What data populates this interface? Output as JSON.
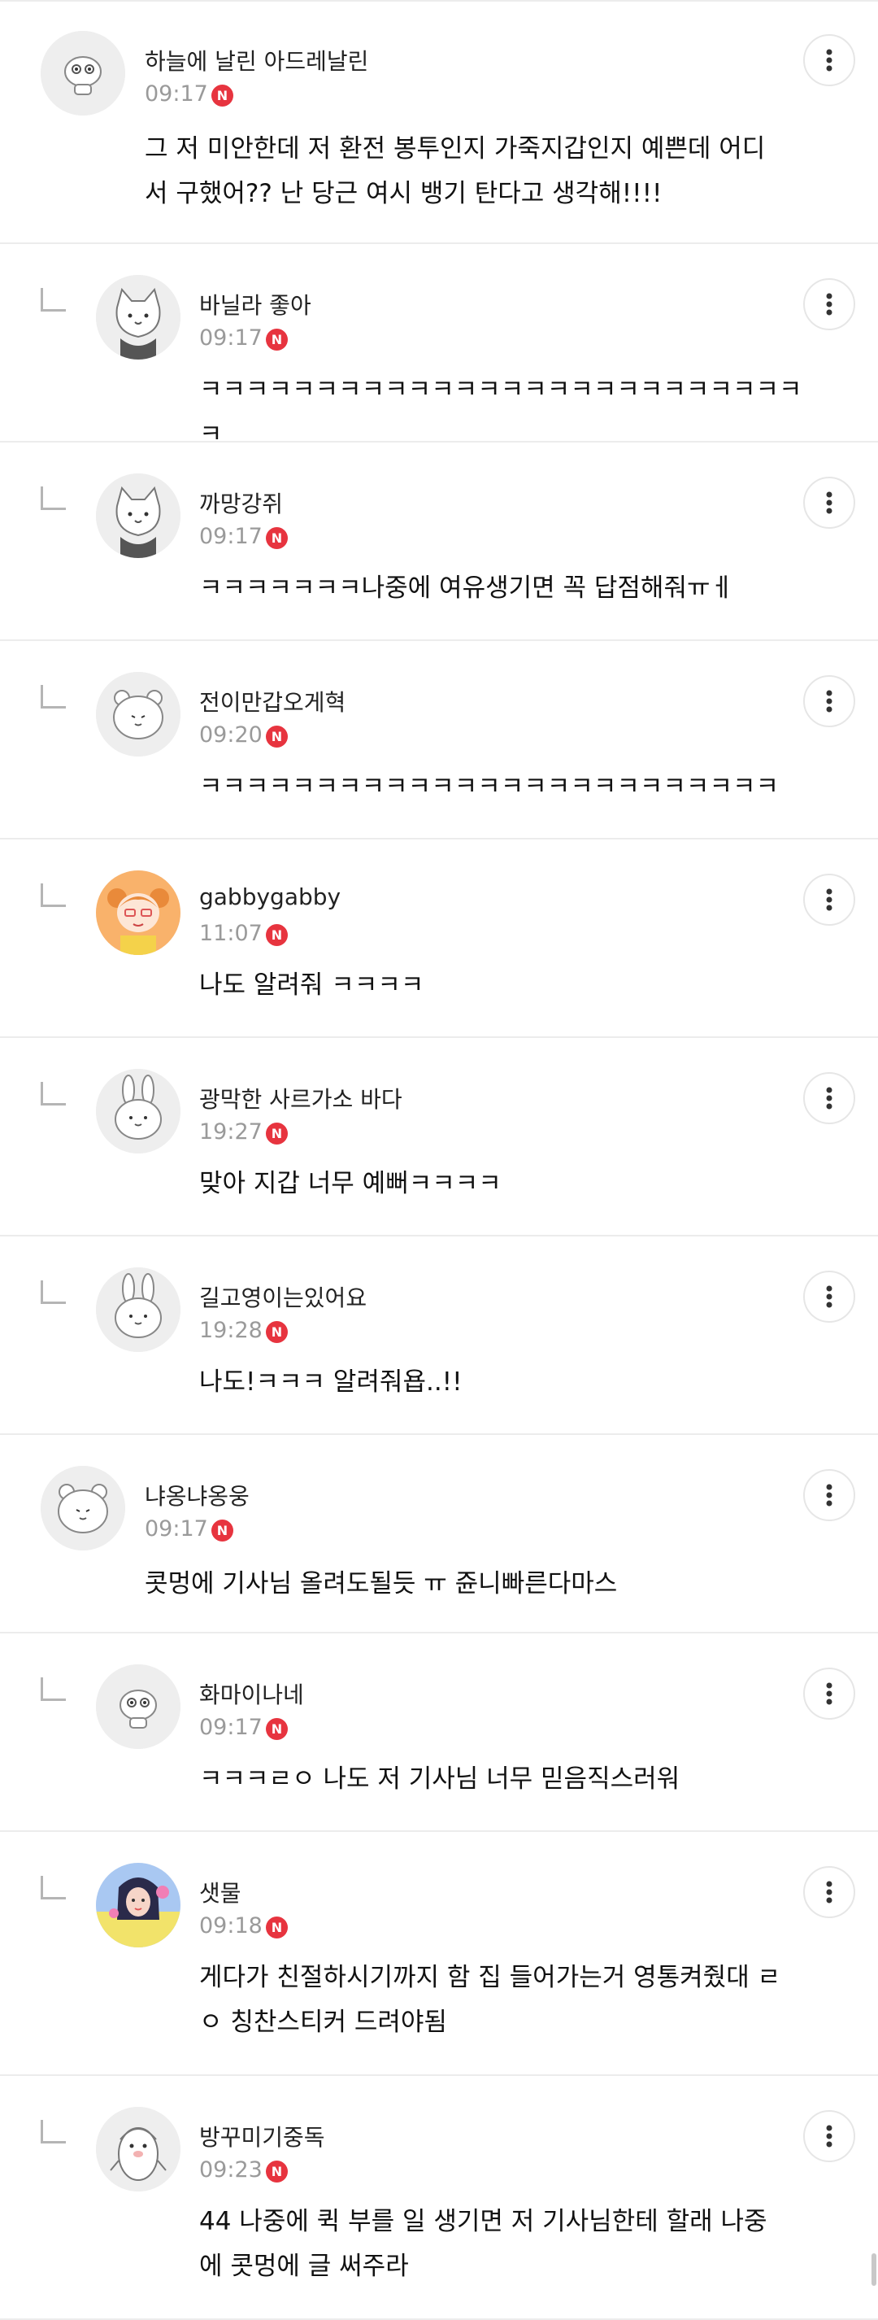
{
  "comments": [
    {
      "nickname": "하늘에 날린 아드레날린",
      "time": "09:17",
      "badge": "N",
      "reply": false,
      "avatar": "doll-avatar-icon",
      "text": "그 저 미안한데 저 환전 봉투인지 가죽지갑인지 예쁜데 어디\n서 구했어?? 난 당근 여시 뱅기 탄다고 생각해!!!!"
    },
    {
      "nickname": "바닐라 좋아",
      "time": "09:17",
      "badge": "N",
      "reply": true,
      "avatar": "cat-avatar-icon",
      "text": "ㅋㅋㅋㅋㅋㅋㅋㅋㅋㅋㅋㅋㅋㅋㅋㅋㅋㅋㅋㅋㅋㅋㅋㅋㅋㅋㅋ"
    },
    {
      "nickname": "까망강쥐",
      "time": "09:17",
      "badge": "N",
      "reply": true,
      "avatar": "cat-avatar-icon",
      "text": "ㅋㅋㅋㅋㅋㅋㅋ나중에 여유생기면 꼭 답점해줘ㅠㅔ"
    },
    {
      "nickname": "전이만갑오게혁",
      "time": "09:20",
      "badge": "N",
      "reply": true,
      "avatar": "bear-avatar-icon",
      "text": "ㅋㅋㅋㅋㅋㅋㅋㅋㅋㅋㅋㅋㅋㅋㅋㅋㅋㅋㅋㅋㅋㅋㅋㅋㅋ"
    },
    {
      "nickname": "gabbygabby",
      "time": "11:07",
      "badge": "N",
      "reply": true,
      "avatar": "girl-avatar-icon",
      "text": "나도 알려줘 ㅋㅋㅋㅋ"
    },
    {
      "nickname": "광막한 사르가소 바다",
      "time": "19:27",
      "badge": "N",
      "reply": true,
      "avatar": "rabbit-avatar-icon",
      "text": "맞아 지갑 너무 예뻐ㅋㅋㅋㅋ"
    },
    {
      "nickname": "길고영이는있어요",
      "time": "19:28",
      "badge": "N",
      "reply": true,
      "avatar": "rabbit-avatar-icon",
      "text": "나도!ㅋㅋㅋ 알려줘욥..!!"
    },
    {
      "nickname": "냐옹냐옹웅",
      "time": "09:17",
      "badge": "N",
      "reply": false,
      "avatar": "bear-avatar-icon",
      "text": "콧멍에 기사님 올려도될듯 ㅠ 쥰니빠른다마스"
    },
    {
      "nickname": "화마이나네",
      "time": "09:17",
      "badge": "N",
      "reply": true,
      "avatar": "doll-avatar-icon",
      "text": "ㅋㅋㅋㄹㅇ 나도 저 기사님 너무 믿음직스러워"
    },
    {
      "nickname": "샛물",
      "time": "09:18",
      "badge": "N",
      "reply": true,
      "avatar": "photo-avatar-icon",
      "text": "게다가 친절하시기까지 함 집 들어가는거 영통켜줬대 ㄹ\nㅇ 칭찬스티커 드려야됨"
    },
    {
      "nickname": "방꾸미기중독",
      "time": "09:23",
      "badge": "N",
      "reply": true,
      "avatar": "penguin-avatar-icon",
      "text": "44 나중에 퀵 부를 일 생기면 저 기사님한테 할래 나중\n에 콧멍에 글 써주라"
    }
  ]
}
